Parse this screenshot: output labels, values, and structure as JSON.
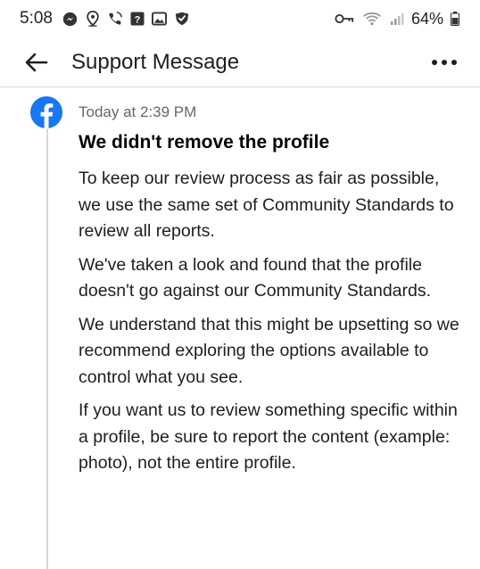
{
  "status_bar": {
    "time": "5:08",
    "battery": "64%",
    "left_icons": [
      "messenger-icon",
      "location-icon",
      "wifi-call-icon",
      "app-icon",
      "gallery-icon",
      "check-shield-icon"
    ],
    "right_icons": [
      "key-icon",
      "wifi-icon",
      "signal-icon",
      "battery-icon"
    ]
  },
  "header": {
    "title": "Support Message"
  },
  "message": {
    "timestamp": "Today at 2:39 PM",
    "title": "We didn't remove the profile",
    "paragraphs": [
      "To keep our review process as fair as possible, we use the same set of Community Standards to review all reports.",
      "We've taken a look and found that the profile doesn't go against our Community Standards.",
      "We understand that this might be upsetting so we recommend exploring the options available to control what you see.",
      "If you want us to review something specific within a profile, be sure to report the content (example: photo), not the entire profile."
    ]
  },
  "colors": {
    "facebook_blue": "#1877f2",
    "divider": "#dadde1",
    "muted_text": "#65676b"
  }
}
